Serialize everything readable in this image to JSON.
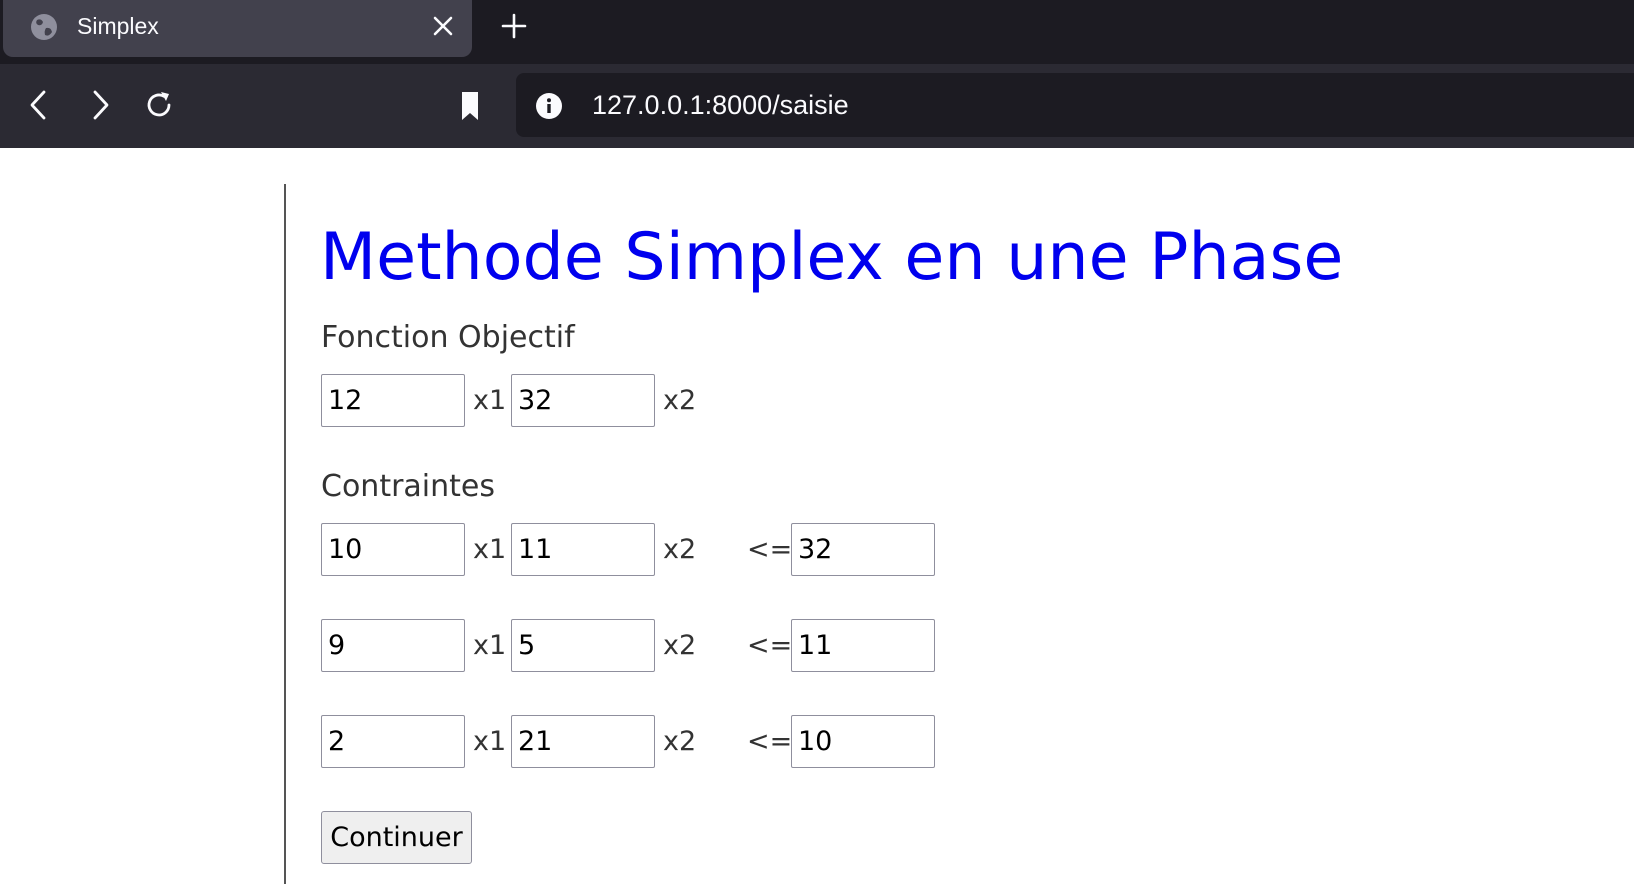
{
  "browser": {
    "tab_title": "Simplex",
    "url": "127.0.0.1:8000/saisie"
  },
  "page": {
    "title": "Methode Simplex en une Phase",
    "objective_label": "Fonction Objectif",
    "constraints_label": "Contraintes",
    "submit_label": "Continuer"
  },
  "objective": {
    "c1": "12",
    "var1": "x1",
    "c2": "32",
    "var2": "x2"
  },
  "constraints": [
    {
      "a1": "10",
      "var1": "x1",
      "a2": "11",
      "var2": "x2",
      "op": "<=",
      "b": "32"
    },
    {
      "a1": "9",
      "var1": "x1",
      "a2": "5",
      "var2": "x2",
      "op": "<=",
      "b": "11"
    },
    {
      "a1": "2",
      "var1": "x1",
      "a2": "21",
      "var2": "x2",
      "op": "<=",
      "b": "10"
    }
  ],
  "icons": {
    "favicon": "globe-icon",
    "tab_close": "close-icon",
    "new_tab": "plus-icon",
    "back": "back-arrow-icon",
    "forward": "forward-arrow-icon",
    "reload": "reload-icon",
    "bookmark": "bookmark-icon",
    "site_info": "info-icon"
  },
  "colors": {
    "title": "#0000ee",
    "chrome_dark": "#1c1b22",
    "chrome_tab": "#42414d",
    "chrome_toolbar": "#2b2a33"
  }
}
